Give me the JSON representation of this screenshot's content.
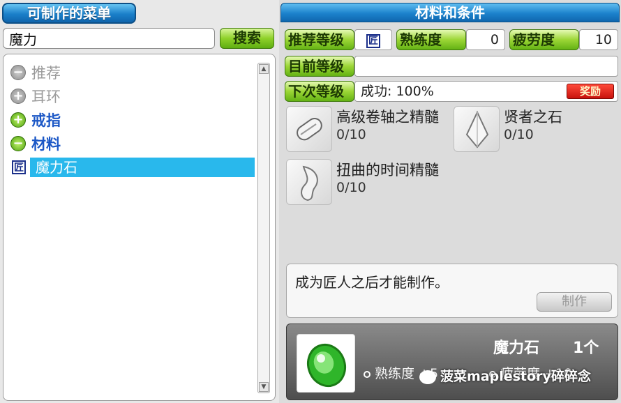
{
  "left_panel": {
    "title": "可制作的菜单",
    "search": {
      "value": "魔力",
      "button_label": "搜索"
    },
    "tree": {
      "items": [
        {
          "label": "推荐",
          "toggle": "−",
          "state": "disabled"
        },
        {
          "label": "耳环",
          "toggle": "+",
          "state": "disabled"
        },
        {
          "label": "戒指",
          "toggle": "+",
          "state": "active"
        },
        {
          "label": "材料",
          "toggle": "−",
          "state": "active"
        }
      ],
      "selected_item": {
        "badge": "匠",
        "label": "魔力石"
      }
    }
  },
  "right_panel": {
    "title": "材料和条件",
    "recommend_level_label": "推荐等级",
    "recommend_badge": "匠",
    "proficiency_label": "熟练度",
    "proficiency_value": "0",
    "fatigue_label": "疲劳度",
    "fatigue_value": "10",
    "current_level_label": "目前等级",
    "next_level_label": "下次等级",
    "success_text": "成功: 100%",
    "reward_label": "奖励",
    "materials": [
      {
        "name": "高级卷轴之精髓",
        "count": "0/10",
        "icon": "scroll-essence-icon"
      },
      {
        "name": "贤者之石",
        "count": "0/10",
        "icon": "sage-stone-icon"
      },
      {
        "name": "扭曲的时间精髓",
        "count": "0/10",
        "icon": "time-essence-icon"
      }
    ],
    "note": "成为匠人之后才能制作。",
    "craft_button_label": "制作",
    "result": {
      "name": "魔力石",
      "quantity": "1个",
      "stat1": "熟练度 +5",
      "stat2": "疲劳度 +10",
      "watermark": "菠菜maplestory碎碎念"
    }
  },
  "colors": {
    "title_blue": "#1a7fc9",
    "tag_green": "#9cd636",
    "selection_blue": "#29b8ec",
    "reward_red": "#d9140f"
  }
}
